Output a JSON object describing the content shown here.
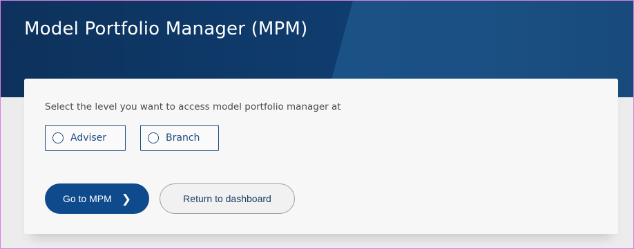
{
  "header": {
    "title": "Model Portfolio Manager (MPM)"
  },
  "panel": {
    "prompt": "Select the level you want to access model portfolio manager at",
    "options": [
      {
        "label": "Adviser",
        "selected": false
      },
      {
        "label": "Branch",
        "selected": false
      }
    ],
    "primary_button": {
      "label": "Go to MPM",
      "icon": "chevron-right-icon"
    },
    "secondary_button": {
      "label": "Return to dashboard"
    }
  },
  "colors": {
    "header_bg": "#0f3c6d",
    "accent": "#0e4a8c",
    "panel_bg": "#f7f7f7",
    "page_bg": "#ececec"
  }
}
